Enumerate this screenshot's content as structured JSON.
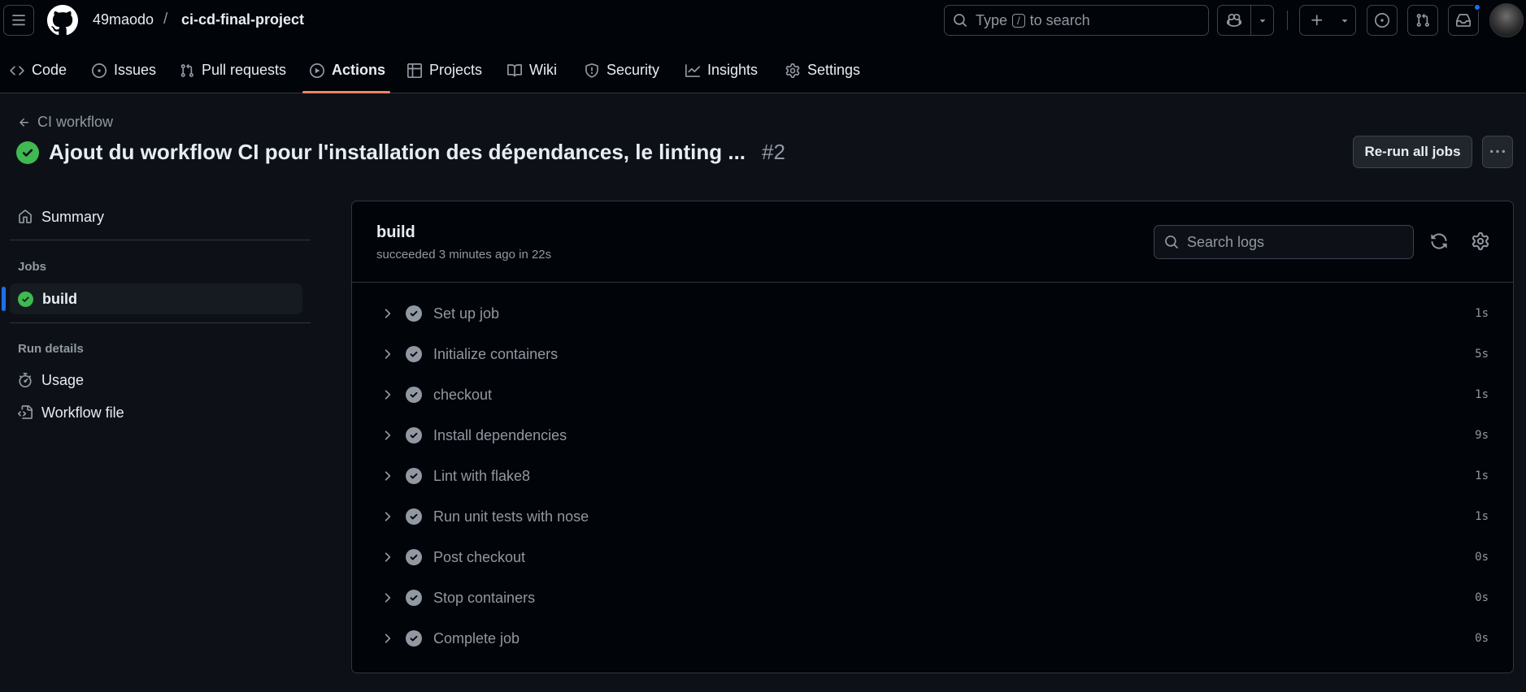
{
  "header": {
    "owner": "49maodo",
    "separator": "/",
    "repo": "ci-cd-final-project",
    "search": {
      "prefix": "Type",
      "key": "/",
      "suffix": "to search"
    }
  },
  "repo_nav": {
    "tabs": [
      {
        "label": "Code",
        "icon": "code-icon"
      },
      {
        "label": "Issues",
        "icon": "issue-opened-icon"
      },
      {
        "label": "Pull requests",
        "icon": "git-pull-request-icon"
      },
      {
        "label": "Actions",
        "icon": "play-icon",
        "active": true
      },
      {
        "label": "Projects",
        "icon": "table-icon"
      },
      {
        "label": "Wiki",
        "icon": "book-icon"
      },
      {
        "label": "Security",
        "icon": "shield-icon"
      },
      {
        "label": "Insights",
        "icon": "graph-icon"
      },
      {
        "label": "Settings",
        "icon": "gear-icon"
      }
    ]
  },
  "run": {
    "back_label": "CI workflow",
    "title": "Ajout du workflow CI pour l'installation des dépendances, le linting ...",
    "number": "#2",
    "status": "success",
    "rerun_label": "Re-run all jobs"
  },
  "sidebar": {
    "summary_label": "Summary",
    "jobs_heading": "Jobs",
    "job_label": "build",
    "run_details_heading": "Run details",
    "usage_label": "Usage",
    "workflow_file_label": "Workflow file"
  },
  "job": {
    "name": "build",
    "subtitle": "succeeded 3 minutes ago in 22s",
    "search_placeholder": "Search logs",
    "steps": [
      {
        "name": "Set up job",
        "duration": "1s"
      },
      {
        "name": "Initialize containers",
        "duration": "5s"
      },
      {
        "name": "checkout",
        "duration": "1s"
      },
      {
        "name": "Install dependencies",
        "duration": "9s"
      },
      {
        "name": "Lint with flake8",
        "duration": "1s"
      },
      {
        "name": "Run unit tests with nose",
        "duration": "1s"
      },
      {
        "name": "Post checkout",
        "duration": "0s"
      },
      {
        "name": "Stop containers",
        "duration": "0s"
      },
      {
        "name": "Complete job",
        "duration": "0s"
      }
    ]
  },
  "colors": {
    "success": "#3fb950",
    "step_done": "#9198a1",
    "accent": "#f78166",
    "link": "#1f6feb"
  }
}
